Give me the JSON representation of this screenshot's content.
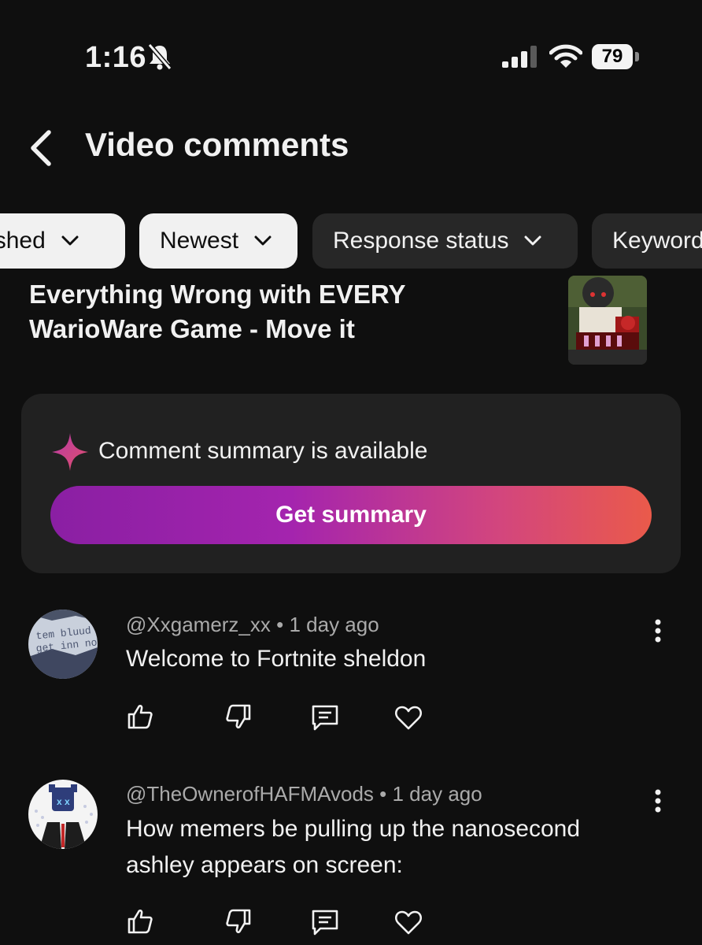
{
  "status_bar": {
    "time": "1:16",
    "battery": "79"
  },
  "header": {
    "title": "Video comments"
  },
  "filters": [
    {
      "label": "Published",
      "style": "light"
    },
    {
      "label": "Newest",
      "style": "light"
    },
    {
      "label": "Response status",
      "style": "dark"
    },
    {
      "label": "Keywords",
      "style": "dark"
    }
  ],
  "video": {
    "title": "Everything Wrong with EVERY WarioWare Game - Move it"
  },
  "summary": {
    "message": "Comment summary is available",
    "button_label": "Get summary"
  },
  "comments": [
    {
      "handle": "@Xxgamerz_xx",
      "separator": "•",
      "time": "1 day ago",
      "text": "Welcome to Fortnite sheldon",
      "avatar_text_1": "tem bluud",
      "avatar_text_2": "get inn now"
    },
    {
      "handle": "@TheOwnerofHAFMAvods",
      "separator": "•",
      "time": "1 day ago",
      "text": "How memers be pulling up the nanosecond ashley appears on screen:"
    }
  ],
  "colors": {
    "background": "#0f0f0f",
    "card": "#212121",
    "chip_dark": "#272727",
    "chip_light": "#f1f1f1",
    "gradient_start": "#8a1fa3",
    "gradient_end": "#ea5a4a"
  }
}
